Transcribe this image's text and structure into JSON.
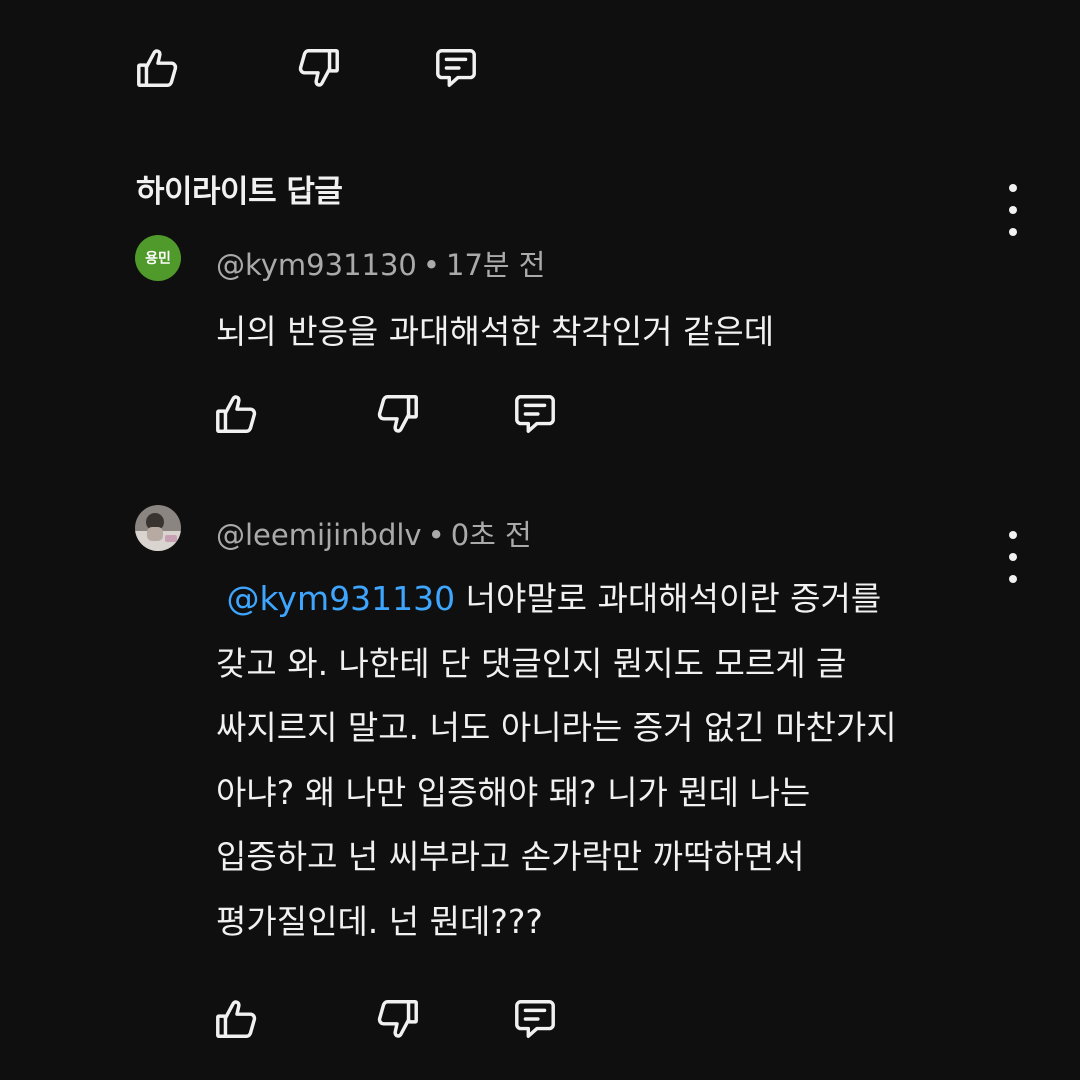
{
  "section": {
    "title": "하이라이트 답글"
  },
  "top_actions": {
    "like_icon": "thumbs-up-icon",
    "dislike_icon": "thumbs-down-icon",
    "reply_icon": "comment-icon"
  },
  "comments": [
    {
      "avatar_text": "용민",
      "avatar_color": "#4f9a2a",
      "author": "@kym931130",
      "separator": "•",
      "time": "17분 전",
      "text": "뇌의 반응을 과대해석한 착각인거 같은데"
    },
    {
      "author": "@leemijinbdlv",
      "separator": "•",
      "time": "0초 전",
      "mention": "@kym931130",
      "lines": [
        "너야말로 과대해석이란 증거를",
        "갖고 와. 나한테 단 댓글인지 뭔지도 모르게 글",
        "싸지르지 말고. 너도 아니라는 증거 없긴 마찬가지",
        "아냐? 왜 나만 입증해야 돼? 니가 뭔데 나는",
        "입증하고 넌 씨부라고 손가락만 까딱하면서",
        "평가질인데. 넌 뭔데???"
      ]
    }
  ],
  "colors": {
    "background": "#0f0f0f",
    "text": "#f1f1f1",
    "meta": "#aaaaaa",
    "mention": "#3ea6ff"
  }
}
